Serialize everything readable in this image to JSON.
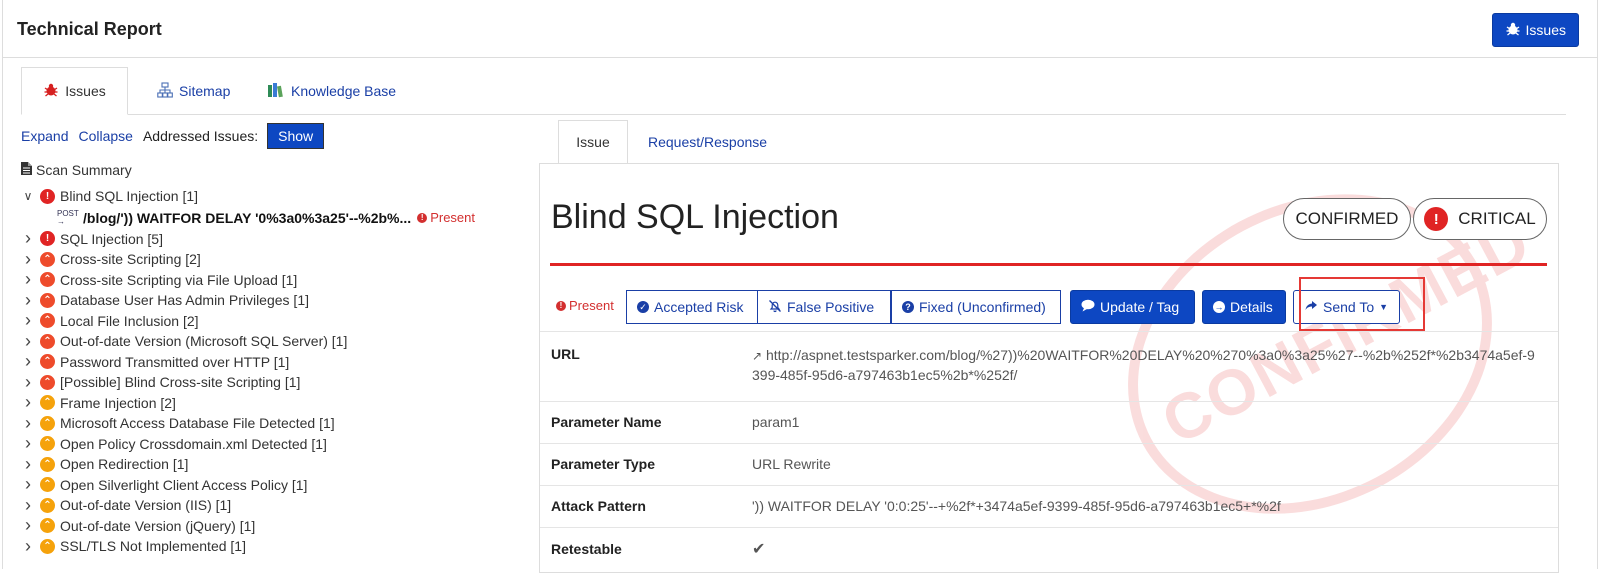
{
  "header": {
    "title": "Technical Report",
    "issues_button": "Issues"
  },
  "main_tabs": [
    {
      "label": "Issues"
    },
    {
      "label": "Sitemap"
    },
    {
      "label": "Knowledge Base"
    }
  ],
  "controls": {
    "expand": "Expand",
    "collapse": "Collapse",
    "addressed_label": "Addressed Issues:",
    "show": "Show"
  },
  "tree": {
    "root": "Scan Summary",
    "expanded_item": {
      "label": "Blind SQL Injection [1]",
      "severity": "critical"
    },
    "sub_item": {
      "method": "POST",
      "path": "/blog/')) WAITFOR DELAY '0%3a0%3a25'--%2b%...",
      "status": "Present"
    },
    "items": [
      {
        "label": "SQL Injection [5]",
        "severity": "critical"
      },
      {
        "label": "Cross-site Scripting [2]",
        "severity": "high"
      },
      {
        "label": "Cross-site Scripting via File Upload [1]",
        "severity": "high"
      },
      {
        "label": "Database User Has Admin Privileges [1]",
        "severity": "high"
      },
      {
        "label": "Local File Inclusion [2]",
        "severity": "high"
      },
      {
        "label": "Out-of-date Version (Microsoft SQL Server) [1]",
        "severity": "high"
      },
      {
        "label": "Password Transmitted over HTTP [1]",
        "severity": "high"
      },
      {
        "label": "[Possible] Blind Cross-site Scripting [1]",
        "severity": "high"
      },
      {
        "label": "Frame Injection [2]",
        "severity": "medium"
      },
      {
        "label": "Microsoft Access Database File Detected [1]",
        "severity": "medium"
      },
      {
        "label": "Open Policy Crossdomain.xml Detected [1]",
        "severity": "medium"
      },
      {
        "label": "Open Redirection [1]",
        "severity": "medium"
      },
      {
        "label": "Open Silverlight Client Access Policy [1]",
        "severity": "medium"
      },
      {
        "label": "Out-of-date Version (IIS) [1]",
        "severity": "medium"
      },
      {
        "label": "Out-of-date Version (jQuery) [1]",
        "severity": "medium"
      },
      {
        "label": "SSL/TLS Not Implemented [1]",
        "severity": "medium"
      }
    ]
  },
  "detail_tabs": [
    {
      "label": "Issue"
    },
    {
      "label": "Request/Response"
    }
  ],
  "issue": {
    "title": "Blind SQL Injection",
    "confirmed": "CONFIRMED",
    "severity": "CRITICAL",
    "stamp_text": "CONFIRMED",
    "status": "Present",
    "actions": {
      "accepted_risk": "Accepted Risk",
      "false_positive": "False Positive",
      "fixed": "Fixed (Unconfirmed)",
      "update_tag": "Update / Tag",
      "details": "Details",
      "send_to": "Send To"
    },
    "fields": {
      "url_label": "URL",
      "url_value": "http://aspnet.testsparker.com/blog/%27))%20WAITFOR%20DELAY%20%270%3a0%3a25%27--%2b%252f*%2b3474a5ef-9399-485f-95d6-a797463b1ec5%2b*%252f/",
      "param_name_label": "Parameter Name",
      "param_name_value": "param1",
      "param_type_label": "Parameter Type",
      "param_type_value": "URL Rewrite",
      "attack_label": "Attack Pattern",
      "attack_value": "')) WAITFOR DELAY '0:0:25'--+%2f*+3474a5ef-9399-485f-95d6-a797463b1ec5+*%2f",
      "retestable_label": "Retestable",
      "retestable_value": "✔"
    }
  },
  "colors": {
    "primary": "#0d47c2",
    "critical": "#e02424",
    "high": "#ee4b2b",
    "medium": "#f5a20b",
    "highlight": "#e53935"
  }
}
